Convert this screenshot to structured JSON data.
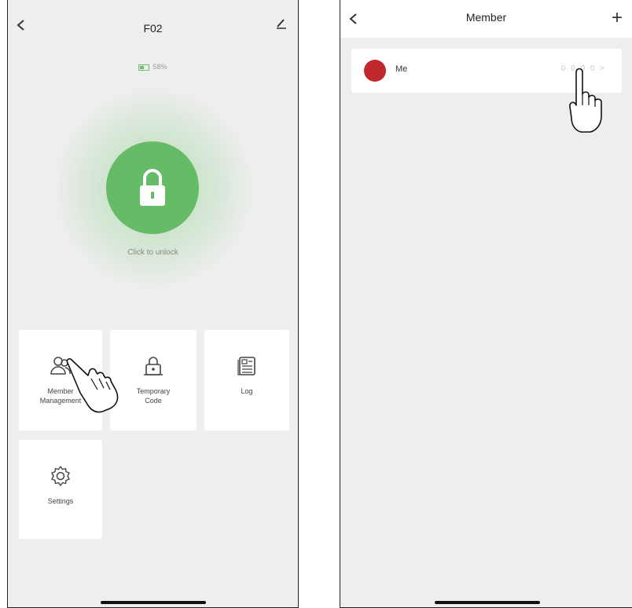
{
  "left_screen": {
    "title": "F02",
    "battery_text": "58%",
    "unlock_label": "Click to unlock",
    "tiles": [
      {
        "label_line1": "Member",
        "label_line2": "Management",
        "icon": "members-icon"
      },
      {
        "label_line1": "Temporary",
        "label_line2": "Code",
        "icon": "temporary-code-lock-icon"
      },
      {
        "label_line1": "Log",
        "label_line2": "",
        "icon": "log-icon"
      },
      {
        "label_line1": "Settings",
        "label_line2": "",
        "icon": "gear-icon"
      }
    ]
  },
  "right_screen": {
    "title": "Member",
    "add_symbol": "+",
    "members": [
      {
        "name": "Me",
        "status": "0 0 0 0 >"
      }
    ]
  },
  "colors": {
    "accent_green": "#66bb66",
    "avatar_red": "#c0282d",
    "background": "#eeeeee"
  }
}
